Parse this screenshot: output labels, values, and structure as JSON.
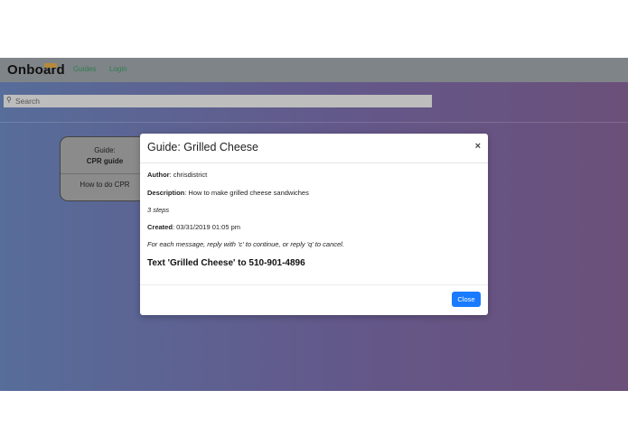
{
  "navbar": {
    "brand": "Onboard",
    "links": [
      {
        "label": "Guides"
      },
      {
        "label": "Login"
      }
    ]
  },
  "search": {
    "placeholder": "Search",
    "value": ""
  },
  "guide_cards": [
    {
      "label": "Guide:",
      "title": "CPR guide",
      "body": "How to do CPR"
    }
  ],
  "modal": {
    "title": "Guide: Grilled Cheese",
    "close_icon": "×",
    "author_label": "Author",
    "author_value": ": chrisdistrict",
    "description_label": "Description",
    "description_value": ": How to make grilled cheese sandwiches",
    "steps": "3 steps",
    "created_label": "Created",
    "created_value": ": 03/31/2019 01:05 pm",
    "instructions": "For each message, reply with 'c' to continue, or reply 'q' to cancel.",
    "cta": "Text 'Grilled Cheese' to 510-901-4896",
    "close_button": "Close"
  },
  "colors": {
    "primary_button": "#1a7bff",
    "nav_link": "#2f7d4f",
    "brand_accent": "#b58a3a"
  }
}
